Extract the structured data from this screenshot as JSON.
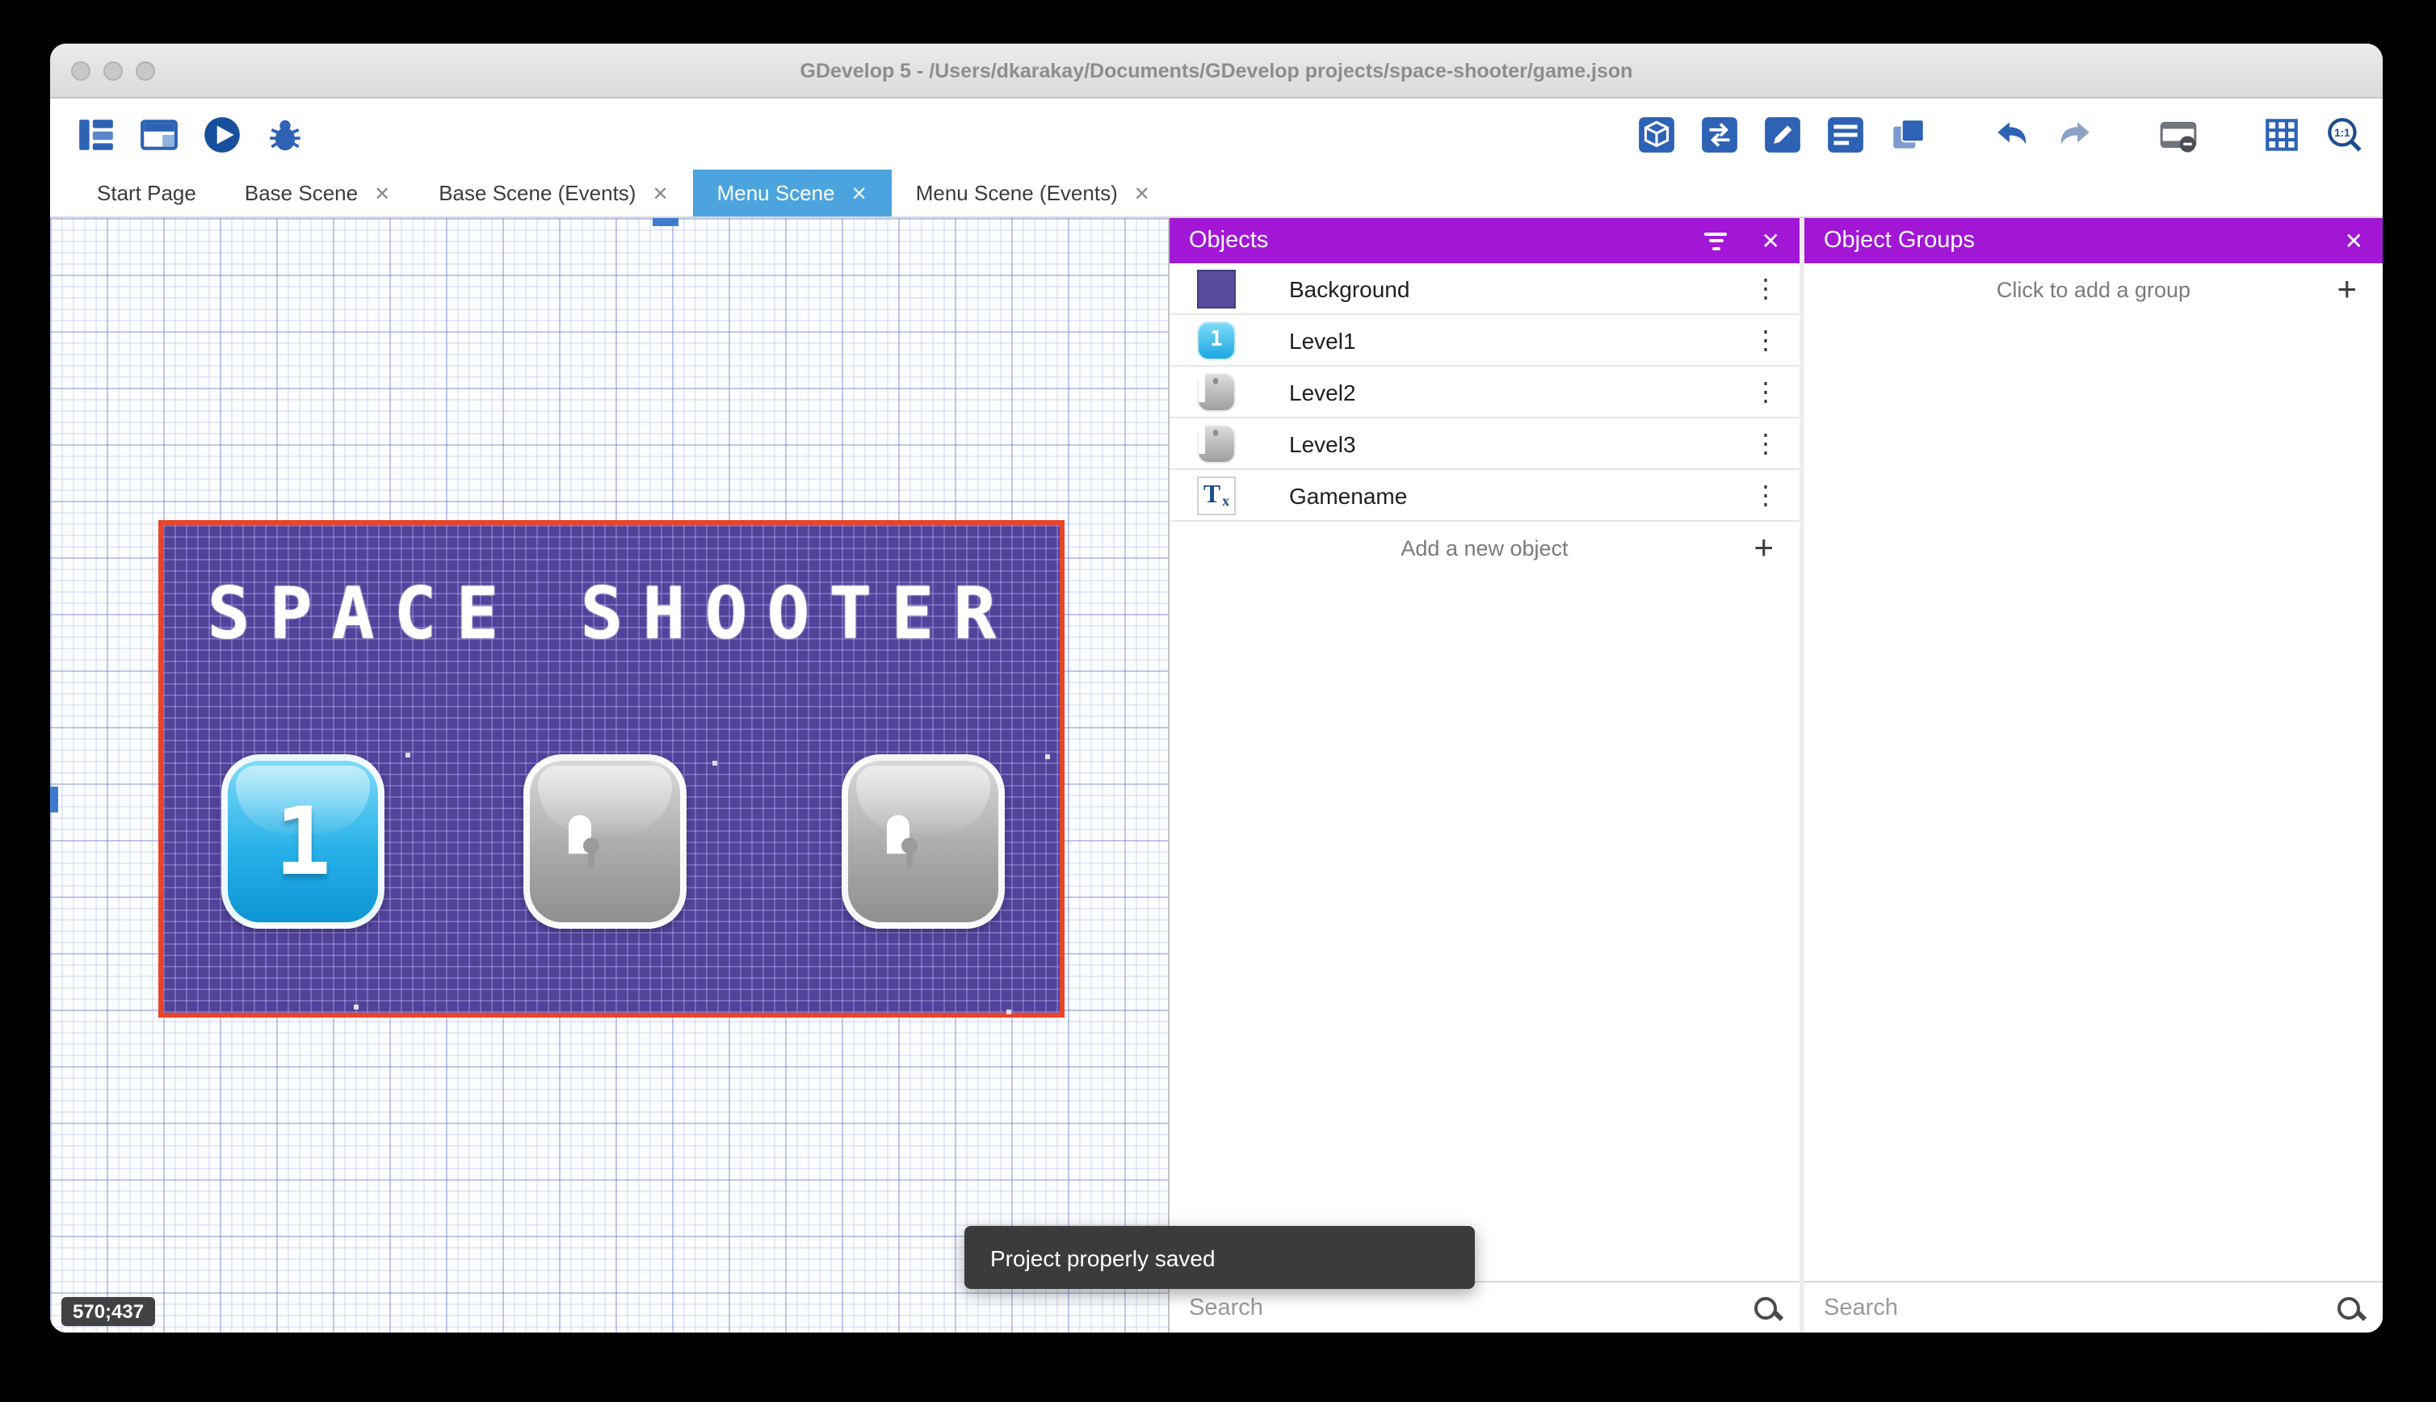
{
  "window": {
    "title": "GDevelop 5 - /Users/dkarakay/Documents/GDevelop projects/space-shooter/game.json"
  },
  "toolbar": {
    "zoom_label": "1:1",
    "left_buttons": [
      {
        "name": "project-manager",
        "icon": "project-manager-icon"
      },
      {
        "name": "scenes",
        "icon": "scene-window-icon"
      },
      {
        "name": "preview",
        "icon": "play-icon"
      },
      {
        "name": "debug",
        "icon": "bug-icon"
      }
    ],
    "right_buttons": [
      {
        "name": "export",
        "icon": "cube-icon"
      },
      {
        "name": "publish",
        "icon": "share-arrows-icon"
      },
      {
        "name": "edit",
        "icon": "pencil-icon"
      },
      {
        "name": "events",
        "icon": "list-icon"
      },
      {
        "name": "duplicate",
        "icon": "layers-icon"
      },
      {
        "name": "undo",
        "icon": "undo-arrow-icon"
      },
      {
        "name": "redo",
        "icon": "redo-arrow-icon"
      },
      {
        "name": "preview-options",
        "icon": "film-icon"
      },
      {
        "name": "toggle-grid",
        "icon": "grid-icon"
      },
      {
        "name": "zoom-reset",
        "icon": "zoom-1-1-icon"
      }
    ]
  },
  "tabs": [
    {
      "label": "Start Page",
      "active": false,
      "closable": false
    },
    {
      "label": "Base Scene",
      "active": false,
      "closable": true
    },
    {
      "label": "Base Scene (Events)",
      "active": false,
      "closable": true
    },
    {
      "label": "Menu Scene",
      "active": true,
      "closable": true
    },
    {
      "label": "Menu Scene (Events)",
      "active": false,
      "closable": true
    }
  ],
  "canvas": {
    "scene_title": "SPACE SHOOTER",
    "level_buttons": [
      {
        "label": "1",
        "state": "unlocked"
      },
      {
        "label": "",
        "state": "locked"
      },
      {
        "label": "",
        "state": "locked"
      }
    ],
    "cursor_coordinates": "570;437"
  },
  "objects_panel": {
    "title": "Objects",
    "items": [
      {
        "label": "Background",
        "icon": "purple-swatch-icon"
      },
      {
        "label": "Level1",
        "icon": "blue-button-icon",
        "icon_label": "1"
      },
      {
        "label": "Level2",
        "icon": "locked-button-icon"
      },
      {
        "label": "Level3",
        "icon": "locked-button-icon"
      },
      {
        "label": "Gamename",
        "icon": "text-object-icon"
      }
    ],
    "add_button_label": "Add a new object",
    "search_placeholder": "Search"
  },
  "groups_panel": {
    "title": "Object Groups",
    "add_button_label": "Click to add a group",
    "search_placeholder": "Search"
  },
  "toast": {
    "message": "Project properly saved"
  },
  "icons": {
    "close": "✕",
    "plus": "+",
    "kebab": "⋮",
    "text_object": "T",
    "text_object_sub": "x"
  },
  "colors": {
    "panel-header": "#A117D5",
    "tab-active": "#4BA4DD",
    "selection-red": "#E8442A",
    "scene-purple": "#52429B",
    "icon-blue": "#2D62B5",
    "toast-bg": "#3B3B3B",
    "level-blue": "#29B2EE"
  }
}
